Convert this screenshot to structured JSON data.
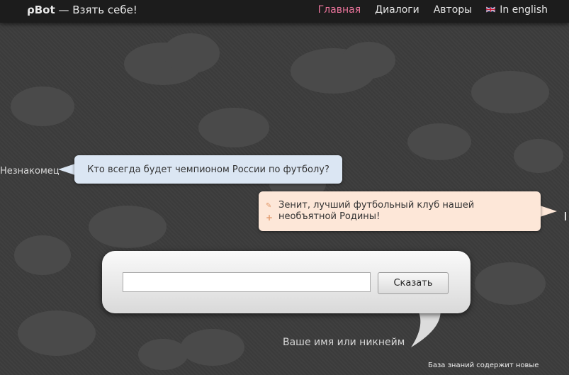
{
  "header": {
    "logo": "ρBot",
    "tagline": "— Взять себе!",
    "nav": [
      {
        "label": "Главная",
        "active": true
      },
      {
        "label": "Диалоги",
        "active": false
      },
      {
        "label": "Авторы",
        "active": false
      },
      {
        "label": "In english",
        "active": false,
        "icon": "uk-flag-icon"
      }
    ]
  },
  "chat": {
    "stranger_label": "Незнакомец",
    "question": "Кто всегда будет чемпионом России по футболу?",
    "answer": "Зенит, лучший футбольный клуб нашей необъятной Родины!"
  },
  "input_form": {
    "message_value": "",
    "say_button": "Сказать",
    "name_prompt": "Ваше имя или никнейм"
  },
  "footer": {
    "note": "База знаний содержит новые"
  },
  "colors": {
    "nav_active": "#e8739a",
    "question_bubble": "#dbe6f3",
    "answer_bubble": "#fde7d8",
    "background": "#3b3b3b"
  }
}
